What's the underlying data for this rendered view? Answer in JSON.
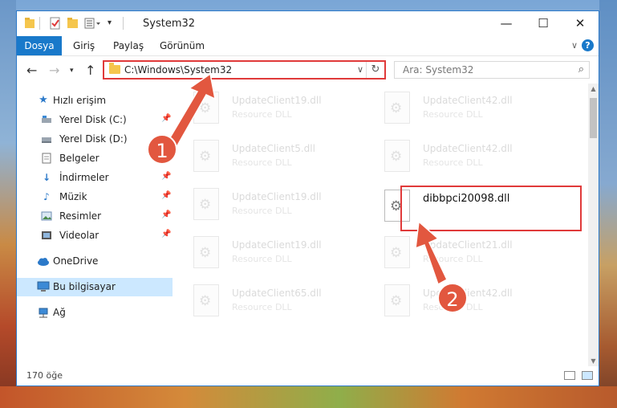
{
  "window": {
    "title": "System32",
    "controls": {
      "minimize": "—",
      "maximize": "☐",
      "close": "✕"
    }
  },
  "ribbon": {
    "file_tab": "Dosya",
    "tabs": [
      "Giriş",
      "Paylaş",
      "Görünüm"
    ]
  },
  "address_bar": {
    "path": "C:\\Windows\\System32"
  },
  "search": {
    "placeholder": "Ara: System32"
  },
  "nav_pane": {
    "items": [
      {
        "label": "Hızlı erişim",
        "icon": "star-icon",
        "pinned": false
      },
      {
        "label": "Yerel Disk (C:)",
        "icon": "drive-icon",
        "pinned": true
      },
      {
        "label": "Yerel Disk (D:)",
        "icon": "drive-icon",
        "pinned": false
      },
      {
        "label": "Belgeler",
        "icon": "documents-icon",
        "pinned": true
      },
      {
        "label": "İndirmeler",
        "icon": "download-icon",
        "pinned": true
      },
      {
        "label": "Müzik",
        "icon": "music-icon",
        "pinned": true
      },
      {
        "label": "Resimler",
        "icon": "pictures-icon",
        "pinned": true
      },
      {
        "label": "Videolar",
        "icon": "video-icon",
        "pinned": true
      },
      {
        "label": "OneDrive",
        "icon": "cloud-icon",
        "pinned": false
      },
      {
        "label": "Bu bilgisayar",
        "icon": "computer-icon",
        "pinned": false,
        "selected": true
      },
      {
        "label": "Ağ",
        "icon": "network-icon",
        "pinned": false
      }
    ]
  },
  "files": [
    {
      "name": "UpdateClient19.dll",
      "type": "Resource DLL"
    },
    {
      "name": "UpdateClient42.dll",
      "type": "Resource DLL"
    },
    {
      "name": "UpdateClient5.dll",
      "type": "Resource DLL"
    },
    {
      "name": "UpdateClient42.dll",
      "type": "Resource DLL"
    },
    {
      "name": "UpdateClient19.dll",
      "type": "Resource DLL"
    },
    {
      "name": "dibbpci20098.dll",
      "type": "",
      "highlighted": true
    },
    {
      "name": "UpdateClient19.dll",
      "type": "Resource DLL"
    },
    {
      "name": "UpdateClient21.dll",
      "type": "Resource DLL"
    },
    {
      "name": "UpdateClient65.dll",
      "type": "Resource DLL"
    },
    {
      "name": "UpdateClient42.dll",
      "type": "Resource DLL"
    }
  ],
  "status_bar": {
    "item_count": "170 öğe"
  },
  "annotations": {
    "step1": "1",
    "step2": "2",
    "color": "#e2573f"
  }
}
